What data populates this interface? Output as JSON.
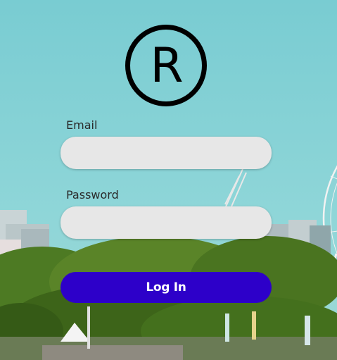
{
  "brand": {
    "logo_letter": "R",
    "logo_icon": "registered-icon"
  },
  "form": {
    "email": {
      "label": "Email",
      "value": "",
      "placeholder": ""
    },
    "password": {
      "label": "Password",
      "value": "",
      "placeholder": ""
    },
    "submit_label": "Log In"
  },
  "colors": {
    "button": "#2d00c9",
    "field": "#e7e7e7",
    "sky": "#7fcfd4"
  }
}
